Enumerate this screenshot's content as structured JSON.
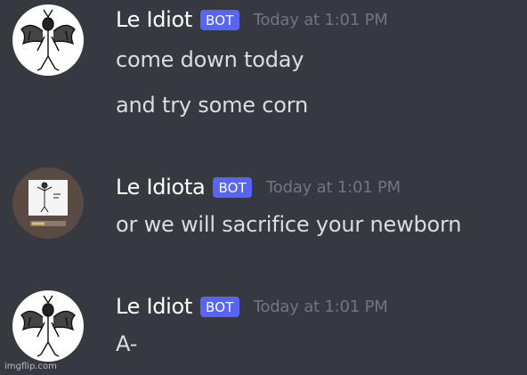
{
  "messages": [
    {
      "username": "Le Idiot",
      "bot_tag": "BOT",
      "timestamp": "Today at 1:01 PM",
      "avatar_icon": "bat-creature-avatar",
      "lines": [
        "come down today",
        "and try some corn"
      ]
    },
    {
      "username": "Le Idiota",
      "bot_tag": "BOT",
      "timestamp": "Today at 1:01 PM",
      "avatar_icon": "meme-thumbnail-avatar",
      "lines": [
        "or we will sacrifice your newborn"
      ]
    },
    {
      "username": "Le Idiot",
      "bot_tag": "BOT",
      "timestamp": "Today at 1:01 PM",
      "avatar_icon": "bat-creature-avatar",
      "lines": [
        "A-"
      ]
    }
  ],
  "watermark": "imgflip.com",
  "colors": {
    "background": "#36393f",
    "bot_tag": "#5865f2",
    "username": "#ffffff",
    "timestamp": "#72767d",
    "message_text": "#dcddde"
  }
}
